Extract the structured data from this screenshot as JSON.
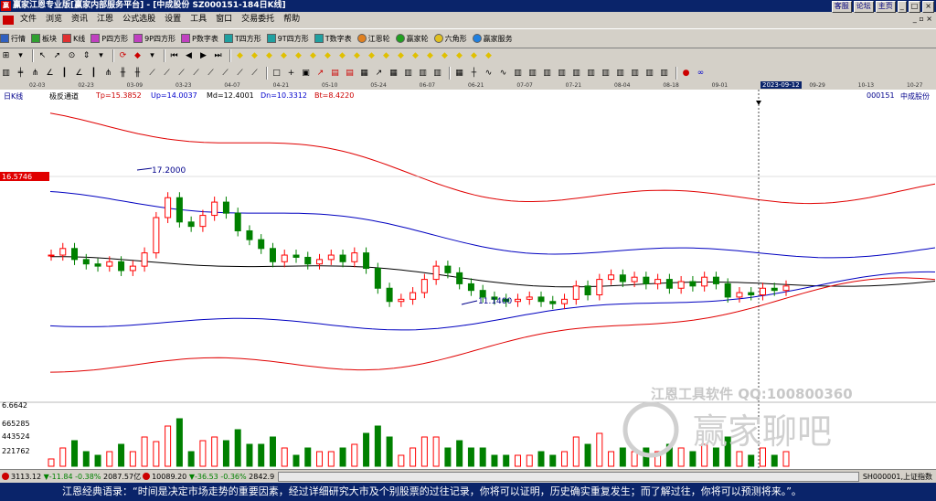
{
  "window": {
    "logo": "赢",
    "title": "赢家江恩专业版[赢家内部服务平台] - [中成股份  SZ000151-184日K线]",
    "buttons": [
      "客服",
      "论坛",
      "主页",
      "_",
      "□",
      "×"
    ]
  },
  "menu": {
    "items": [
      "文件",
      "浏览",
      "资讯",
      "江恩",
      "公式选股",
      "设置",
      "工具",
      "窗口",
      "交易委托",
      "帮助"
    ],
    "right": "_ ▫ ×"
  },
  "toolbar": {
    "items": [
      "行情",
      "板块",
      "K线",
      "P四方形",
      "9P四方形",
      "P数字表",
      "T四方形",
      "9T四方形",
      "T数字表",
      "江恩轮",
      "赢家轮",
      "六角形",
      "赢家服务"
    ]
  },
  "dates": [
    "02-03",
    "02-23",
    "03-09",
    "03-23",
    "04-07",
    "04-21",
    "05-10",
    "05-24",
    "06-07",
    "06-21",
    "07-07",
    "07-21",
    "08-04",
    "08-18",
    "09-01",
    "2023-09-12",
    "09-29",
    "10-13",
    "10-27"
  ],
  "chart_header": {
    "period": "日K线",
    "indicator": "极反通道",
    "tp": "Tp=15.3852",
    "up": "Up=14.0037",
    "md": "Md=12.4001",
    "dn": "Dn=10.3312",
    "bt": "Bt=8.4220",
    "code": "000151",
    "name": "中成股份"
  },
  "price_label": "16.5746",
  "annotations": {
    "high": "17.2000",
    "low": "11.1400"
  },
  "volume_axis": [
    "6.6642",
    "665285",
    "443524",
    "221762"
  ],
  "watermark": {
    "line1": "江恩工具软件  QQ:100800360",
    "line2": "赢家聊吧"
  },
  "status": {
    "sh_val": "3113.12",
    "sh_chg": "▼-11.84",
    "sh_pct": "-0.38%",
    "sh_amt": "2087.57亿",
    "sz_val": "10089.20",
    "sz_chg": "▼-36.53",
    "sz_pct": "-0.36%",
    "sz_amt": "2842.9",
    "right": "SH000001,上证指数"
  },
  "quote": "江恩经典语录：“时间是决定市场走势的重要因素，经过详细研究大市及个别股票的过往记录，你将可以证明，历史确实重复发生；而了解过往，你将可以预测将来。”。",
  "colors": {
    "up": "#ff0000",
    "down": "#008000",
    "outer_band": "#e00000",
    "inner_band": "#0000c0",
    "mid": "#000000"
  },
  "chart_data": {
    "type": "candlestick",
    "title": "中成股份 SZ000151 日K线",
    "price_range": [
      7.0,
      20.5
    ],
    "indicator": {
      "name": "极反通道",
      "Tp": 15.3852,
      "Up": 14.0037,
      "Md": 12.4001,
      "Dn": 10.3312,
      "Bt": 8.422
    },
    "high_label": 17.2,
    "low_label": 11.14,
    "close_approx": [
      13.5,
      13.8,
      13.3,
      13.1,
      13.0,
      13.2,
      12.8,
      13.0,
      13.6,
      15.2,
      16.1,
      15.0,
      14.8,
      15.3,
      15.9,
      15.4,
      14.6,
      14.2,
      13.8,
      13.2,
      13.5,
      13.4,
      13.1,
      13.3,
      13.5,
      13.2,
      13.6,
      12.9,
      12.0,
      11.4,
      11.5,
      11.8,
      12.4,
      13.0,
      12.7,
      12.2,
      11.9,
      11.6,
      11.5,
      11.4,
      11.5,
      11.6,
      11.4,
      11.3,
      11.5,
      12.1,
      11.7,
      12.4,
      12.6,
      12.3,
      12.5,
      12.2,
      12.4,
      12.0,
      12.3,
      12.1,
      12.5,
      12.2,
      11.6,
      11.8,
      11.7,
      12.0,
      11.9,
      12.1
    ]
  }
}
